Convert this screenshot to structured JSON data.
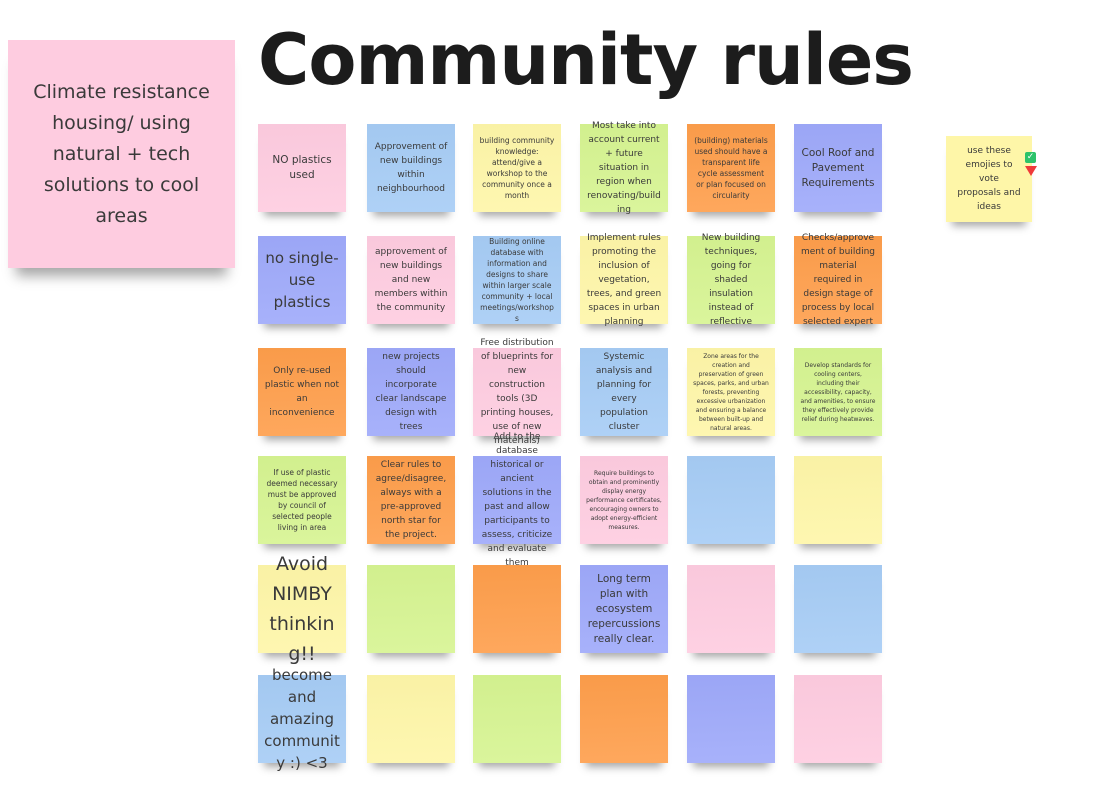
{
  "board": {
    "title": "Community rules"
  },
  "main_note": {
    "text": "Climate resistance housing/ using natural + tech solutions to cool areas",
    "color": "#fecce0"
  },
  "vote_note": {
    "text": "use these emojies to vote proposals and ideas",
    "color": "#fef6a8",
    "icons": [
      {
        "name": "check-icon",
        "glyph": "✓",
        "color": "#2dc36a"
      },
      {
        "name": "down-triangle-icon",
        "glyph": "▼",
        "color": "#ef3a3a"
      }
    ]
  },
  "notes": [
    {
      "row": 0,
      "col": 0,
      "color": "pink",
      "size": "l",
      "text": "NO plastics used"
    },
    {
      "row": 0,
      "col": 1,
      "color": "blue",
      "size": "m",
      "text": "Approvement of new buildings within neighbourhood"
    },
    {
      "row": 0,
      "col": 2,
      "color": "yellow",
      "size": "s",
      "text": "building community knowledge: attend/give a workshop to the community once a month"
    },
    {
      "row": 0,
      "col": 3,
      "color": "green",
      "size": "m",
      "text": "Most take into account current + future situation in region when renovating/building"
    },
    {
      "row": 0,
      "col": 4,
      "color": "orange",
      "size": "s",
      "text": "(building) materials used should have a transparent life cycle assessment or plan focused on circularity"
    },
    {
      "row": 0,
      "col": 5,
      "color": "violet",
      "size": "l",
      "text": "Cool Roof and Pavement Requirements"
    },
    {
      "row": 1,
      "col": 0,
      "color": "violet",
      "size": "xl",
      "text": "no single-use plastics"
    },
    {
      "row": 1,
      "col": 1,
      "color": "pink",
      "size": "m",
      "text": "approvement of new buildings and new members within the community"
    },
    {
      "row": 1,
      "col": 2,
      "color": "blue",
      "size": "s",
      "text": "Building online database with information and designs to share within larger scale community + local meetings/workshops"
    },
    {
      "row": 1,
      "col": 3,
      "color": "yellow",
      "size": "m",
      "text": "Implement rules promoting the inclusion of vegetation, trees, and green spaces in urban planning"
    },
    {
      "row": 1,
      "col": 4,
      "color": "green",
      "size": "m",
      "text": "New building techniques, going for shaded insulation instead of reflective"
    },
    {
      "row": 1,
      "col": 5,
      "color": "orange",
      "size": "m",
      "text": "Checks/approvement of building material required in design stage of process by local selected expert"
    },
    {
      "row": 2,
      "col": 0,
      "color": "orange",
      "size": "m",
      "text": "Only re-used plastic when not an inconvenience"
    },
    {
      "row": 2,
      "col": 1,
      "color": "violet",
      "size": "m",
      "text": "new projects should incorporate clear landscape design with trees"
    },
    {
      "row": 2,
      "col": 2,
      "color": "pink",
      "size": "m",
      "text": "Free distribution of blueprints for new construction tools (3D printing houses, use of new materials)"
    },
    {
      "row": 2,
      "col": 3,
      "color": "blue",
      "size": "m",
      "text": "Systemic analysis and planning for every population cluster"
    },
    {
      "row": 2,
      "col": 4,
      "color": "yellow",
      "size": "xs",
      "text": "Zone areas for the creation and preservation of green spaces, parks, and urban forests, preventing excessive urbanization and ensuring a balance between built-up and natural areas."
    },
    {
      "row": 2,
      "col": 5,
      "color": "green",
      "size": "xs",
      "text": "Develop standards for cooling centers, including their accessibility, capacity, and amenities, to ensure they effectively provide relief during heatwaves."
    },
    {
      "row": 3,
      "col": 0,
      "color": "green",
      "size": "s",
      "text": "If use of plastic deemed necessary must be approved by council of selected people living in area"
    },
    {
      "row": 3,
      "col": 1,
      "color": "orange",
      "size": "m",
      "text": "Clear rules to agree/disagree, always with a pre-approved north star for the project."
    },
    {
      "row": 3,
      "col": 2,
      "color": "violet",
      "size": "m",
      "text": "Add to the database historical or ancient solutions in the past and allow participants to assess, criticize and evaluate them"
    },
    {
      "row": 3,
      "col": 3,
      "color": "pink",
      "size": "xs",
      "text": "Require buildings to obtain and prominently display energy performance certificates, encouraging owners to adopt energy-efficient measures."
    },
    {
      "row": 3,
      "col": 4,
      "color": "blue",
      "size": "m",
      "text": ""
    },
    {
      "row": 3,
      "col": 5,
      "color": "yellow",
      "size": "m",
      "text": ""
    },
    {
      "row": 4,
      "col": 0,
      "color": "yellow",
      "size": "xxl",
      "text": "Avoid NIMBY thinking!!"
    },
    {
      "row": 4,
      "col": 1,
      "color": "green",
      "size": "m",
      "text": ""
    },
    {
      "row": 4,
      "col": 2,
      "color": "orange",
      "size": "m",
      "text": ""
    },
    {
      "row": 4,
      "col": 3,
      "color": "violet",
      "size": "l",
      "text": "Long term plan with ecosystem repercussions really clear."
    },
    {
      "row": 4,
      "col": 4,
      "color": "pink",
      "size": "m",
      "text": ""
    },
    {
      "row": 4,
      "col": 5,
      "color": "blue",
      "size": "m",
      "text": ""
    },
    {
      "row": 5,
      "col": 0,
      "color": "blue",
      "size": "xl",
      "text": "become and amazing community :) <3"
    },
    {
      "row": 5,
      "col": 1,
      "color": "yellow",
      "size": "m",
      "text": ""
    },
    {
      "row": 5,
      "col": 2,
      "color": "green",
      "size": "m",
      "text": ""
    },
    {
      "row": 5,
      "col": 3,
      "color": "orange",
      "size": "m",
      "text": ""
    },
    {
      "row": 5,
      "col": 4,
      "color": "violet",
      "size": "m",
      "text": ""
    },
    {
      "row": 5,
      "col": 5,
      "color": "pink",
      "size": "m",
      "text": ""
    }
  ],
  "palette": {
    "pink": "#fecce0",
    "blue": "#a6ccf5",
    "yellow": "#fef6a8",
    "green": "#d6f491",
    "orange": "#fe9e4b",
    "violet": "#9ea9fa"
  }
}
